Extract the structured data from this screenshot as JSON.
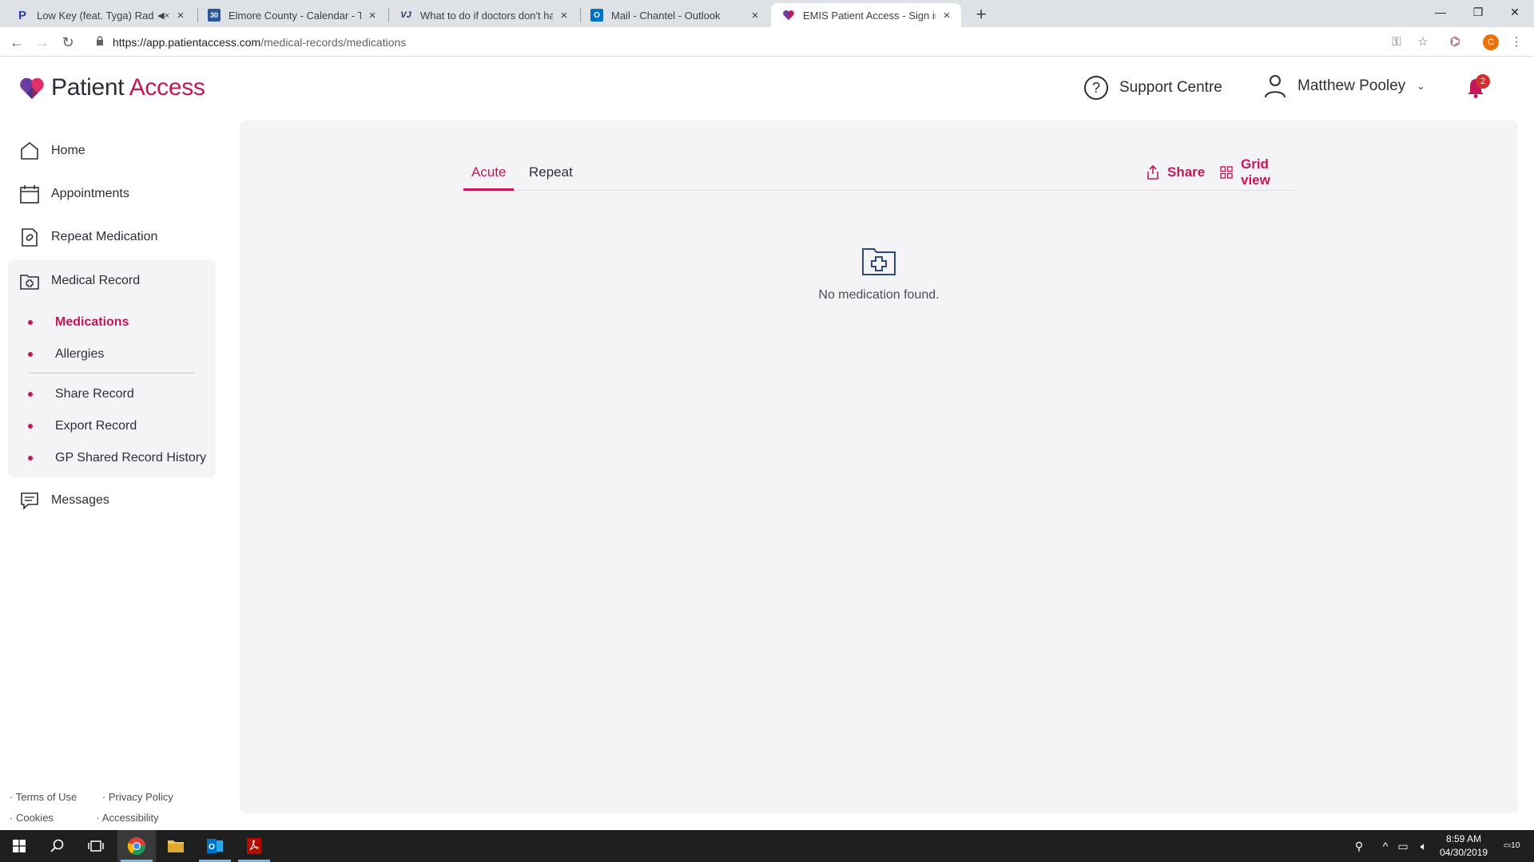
{
  "browser": {
    "tabs": [
      {
        "title": "Low Key (feat. Tyga) Radio -",
        "muted": true,
        "favicon": "pandora-icon"
      },
      {
        "title": "Elmore County - Calendar - Tues",
        "favicon": "calendar-icon",
        "favicon_text": "30"
      },
      {
        "title": "What to do if doctors don't have",
        "favicon": "vj-icon",
        "favicon_text": "VJ"
      },
      {
        "title": "Mail - Chantel - Outlook",
        "favicon": "outlook-icon",
        "favicon_text": "O"
      },
      {
        "title": "EMIS Patient Access - Sign in or r",
        "favicon": "patient-access-icon",
        "active": true
      }
    ],
    "url_host": "https://app.patientaccess.com",
    "url_path": "/medical-records/medications",
    "profile_initial": "C"
  },
  "header": {
    "logo_word1": "Patient",
    "logo_word2": "Access",
    "support_label": "Support Centre",
    "user_name": "Matthew Pooley",
    "notification_count": "2"
  },
  "sidebar": {
    "items": [
      {
        "label": "Home",
        "icon": "home-icon"
      },
      {
        "label": "Appointments",
        "icon": "calendar-icon"
      },
      {
        "label": "Repeat Medication",
        "icon": "prescription-icon"
      },
      {
        "label": "Medical Record",
        "icon": "medical-folder-icon"
      },
      {
        "label": "Messages",
        "icon": "messages-icon"
      }
    ],
    "medical_record_sub": [
      {
        "label": "Medications",
        "active": true
      },
      {
        "label": "Allergies"
      },
      {
        "label": "Share Record"
      },
      {
        "label": "Export Record"
      },
      {
        "label": "GP Shared Record History"
      }
    ],
    "footer": {
      "terms": "Terms of Use",
      "privacy": "Privacy Policy",
      "cookies": "Cookies",
      "accessibility": "Accessibility"
    }
  },
  "main": {
    "tabs": [
      {
        "label": "Acute",
        "active": true
      },
      {
        "label": "Repeat"
      }
    ],
    "share_label": "Share",
    "grid_view_label": "Grid view",
    "empty_message": "No medication found."
  },
  "taskbar": {
    "time": "8:59 AM",
    "date": "04/30/2019",
    "notifications": "10"
  },
  "colors": {
    "accent": "#c2185b",
    "panel_bg": "#f4f4f6",
    "text": "#2d2d3a"
  }
}
